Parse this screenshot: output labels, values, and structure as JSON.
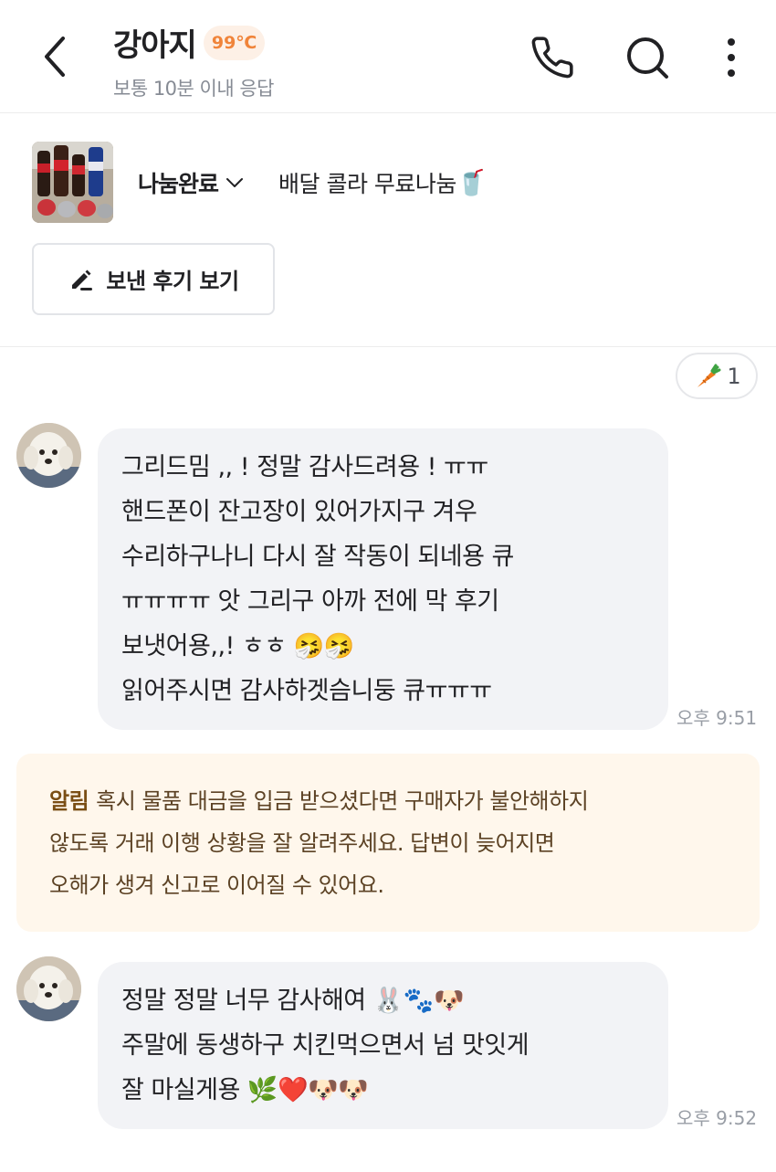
{
  "header": {
    "title": "강아지",
    "temperature": "99℃",
    "subtitle": "보통 10분 이내 응답",
    "icons": [
      "chevron-left-icon",
      "phone-icon",
      "search-icon",
      "more-vertical-icon"
    ]
  },
  "product": {
    "status": "나눔완료",
    "title": "배달 콜라 무료나눔",
    "title_emoji": "🥤",
    "review_button": "보낸 후기 보기"
  },
  "chat": {
    "carrot_count": "1",
    "messages": [
      {
        "lines": [
          "그리드밈 ,, ! 정말 감사드려용 ! ㅠㅠ",
          "핸드폰이 잔고장이 있어가지구 겨우",
          "수리하구나니 다시 잘 작동이 되네용 큐",
          "ㅠㅠㅠㅠ 앗 그리구 아까 전에 막 후기",
          "보냇어용,,! ㅎㅎ 🤧🤧",
          "읽어주시면 감사하겟슴니둥 큐ㅠㅠㅠ"
        ],
        "time": "오후 9:51"
      },
      {
        "lines": [
          "정말 정말 너무 감사해여 🐰🐾🐶",
          "주말에 동생하구 치킨먹으면서 넘 맛잇게",
          "잘 마실게용 🌿❤️🐶🐶"
        ],
        "time": "오후 9:52"
      }
    ],
    "notice": {
      "tag": "알림",
      "lines": [
        "혹시 물품 대금을 입금 받으셨다면 구매자가 불안해하지",
        "않도록 거래 이행 상황을 잘 알려주세요. 답변이 늦어지면",
        "오해가 생겨 신고로 이어질 수 있어요."
      ]
    }
  },
  "colors": {
    "accent_orange": "#f0843a",
    "bubble_bg": "#f2f3f6",
    "notice_bg": "#fff7ec",
    "notice_text": "#5c4224"
  }
}
